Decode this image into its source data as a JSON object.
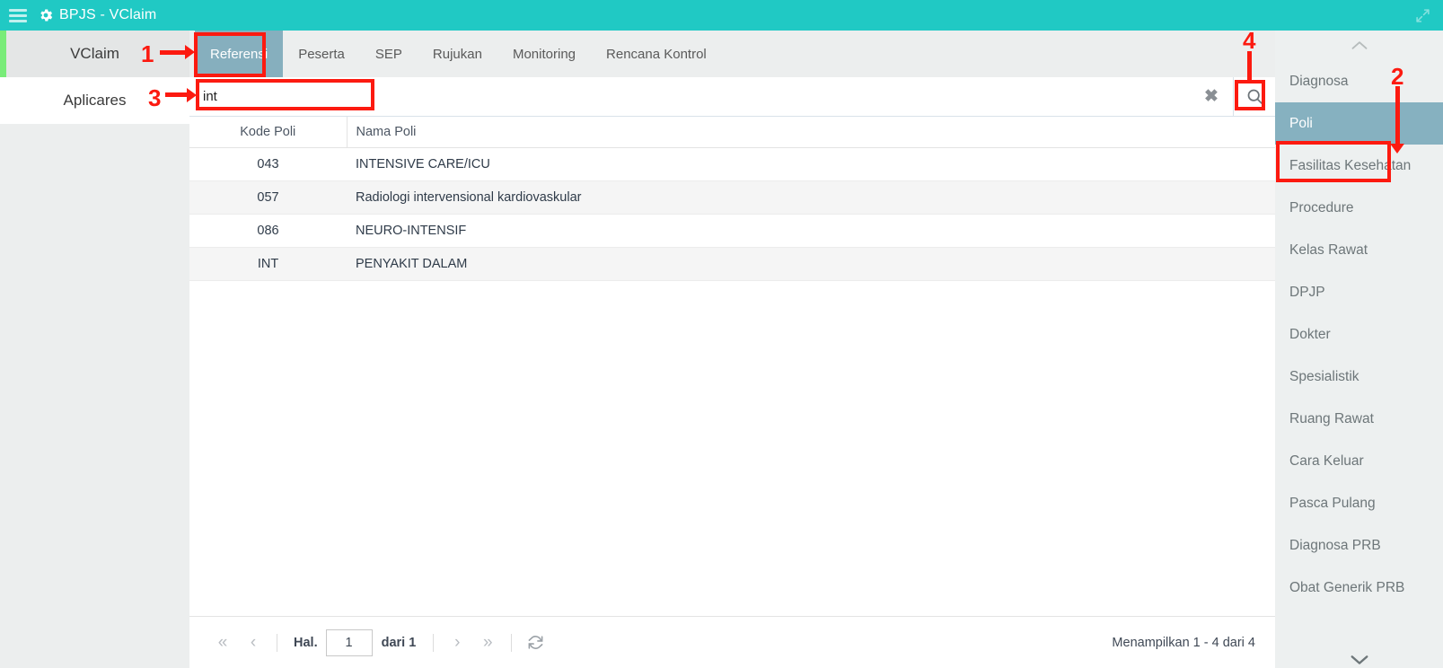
{
  "titlebar": {
    "menu_icon": "hamburger-icon",
    "gear_icon": "gear-icon",
    "title": "BPJS - VClaim",
    "expand_icon": "expand-arrows-icon",
    "background": "#20c9c4"
  },
  "applist": {
    "items": [
      {
        "label": "VClaim",
        "active": true
      },
      {
        "label": "Aplicares",
        "active": false
      }
    ],
    "accent": "#79ec79"
  },
  "topnav": {
    "tabs": [
      {
        "label": "Referensi",
        "active": true
      },
      {
        "label": "Peserta",
        "active": false
      },
      {
        "label": "SEP",
        "active": false
      },
      {
        "label": "Rujukan",
        "active": false
      },
      {
        "label": "Monitoring",
        "active": false
      },
      {
        "label": "Rencana Kontrol",
        "active": false
      }
    ],
    "active_background": "#86afbe"
  },
  "search": {
    "value": "int",
    "placeholder": "",
    "clear_icon": "clear-x-icon",
    "clear_glyph": "✖",
    "search_icon": "search-icon"
  },
  "table": {
    "columns": [
      "Kode Poli",
      "Nama Poli"
    ],
    "rows": [
      {
        "kode": "043",
        "nama": "INTENSIVE CARE/ICU"
      },
      {
        "kode": "057",
        "nama": "Radiologi intervensional kardiovaskular"
      },
      {
        "kode": "086",
        "nama": "NEURO-INTENSIF"
      },
      {
        "kode": "INT",
        "nama": "PENYAKIT DALAM"
      }
    ]
  },
  "pager": {
    "first_glyph": "«",
    "prev_glyph": "‹",
    "next_glyph": "›",
    "last_glyph": "»",
    "page_label": "Hal.",
    "page_value": "1",
    "of_label": "dari 1",
    "refresh_icon": "refresh-icon",
    "status": "Menampilkan 1 - 4 dari 4"
  },
  "rightbar": {
    "scroll_up_icon": "chevron-up-icon",
    "scroll_down_icon": "chevron-down-icon",
    "items": [
      {
        "label": "Diagnosa",
        "active": false
      },
      {
        "label": "Poli",
        "active": true
      },
      {
        "label": "Fasilitas Kesehatan",
        "active": false
      },
      {
        "label": "Procedure",
        "active": false
      },
      {
        "label": "Kelas Rawat",
        "active": false
      },
      {
        "label": "DPJP",
        "active": false
      },
      {
        "label": "Dokter",
        "active": false
      },
      {
        "label": "Spesialistik",
        "active": false
      },
      {
        "label": "Ruang Rawat",
        "active": false
      },
      {
        "label": "Cara Keluar",
        "active": false
      },
      {
        "label": "Pasca Pulang",
        "active": false
      },
      {
        "label": "Diagnosa PRB",
        "active": false
      },
      {
        "label": "Obat Generik PRB",
        "active": false
      }
    ],
    "active_background": "#86b1c0"
  },
  "annotations": {
    "color": "#fc1a10",
    "markers": [
      {
        "number": "1",
        "target": "referensi-tab"
      },
      {
        "number": "2",
        "target": "poli-sidebar-item"
      },
      {
        "number": "3",
        "target": "search-input"
      },
      {
        "number": "4",
        "target": "search-button"
      }
    ]
  }
}
